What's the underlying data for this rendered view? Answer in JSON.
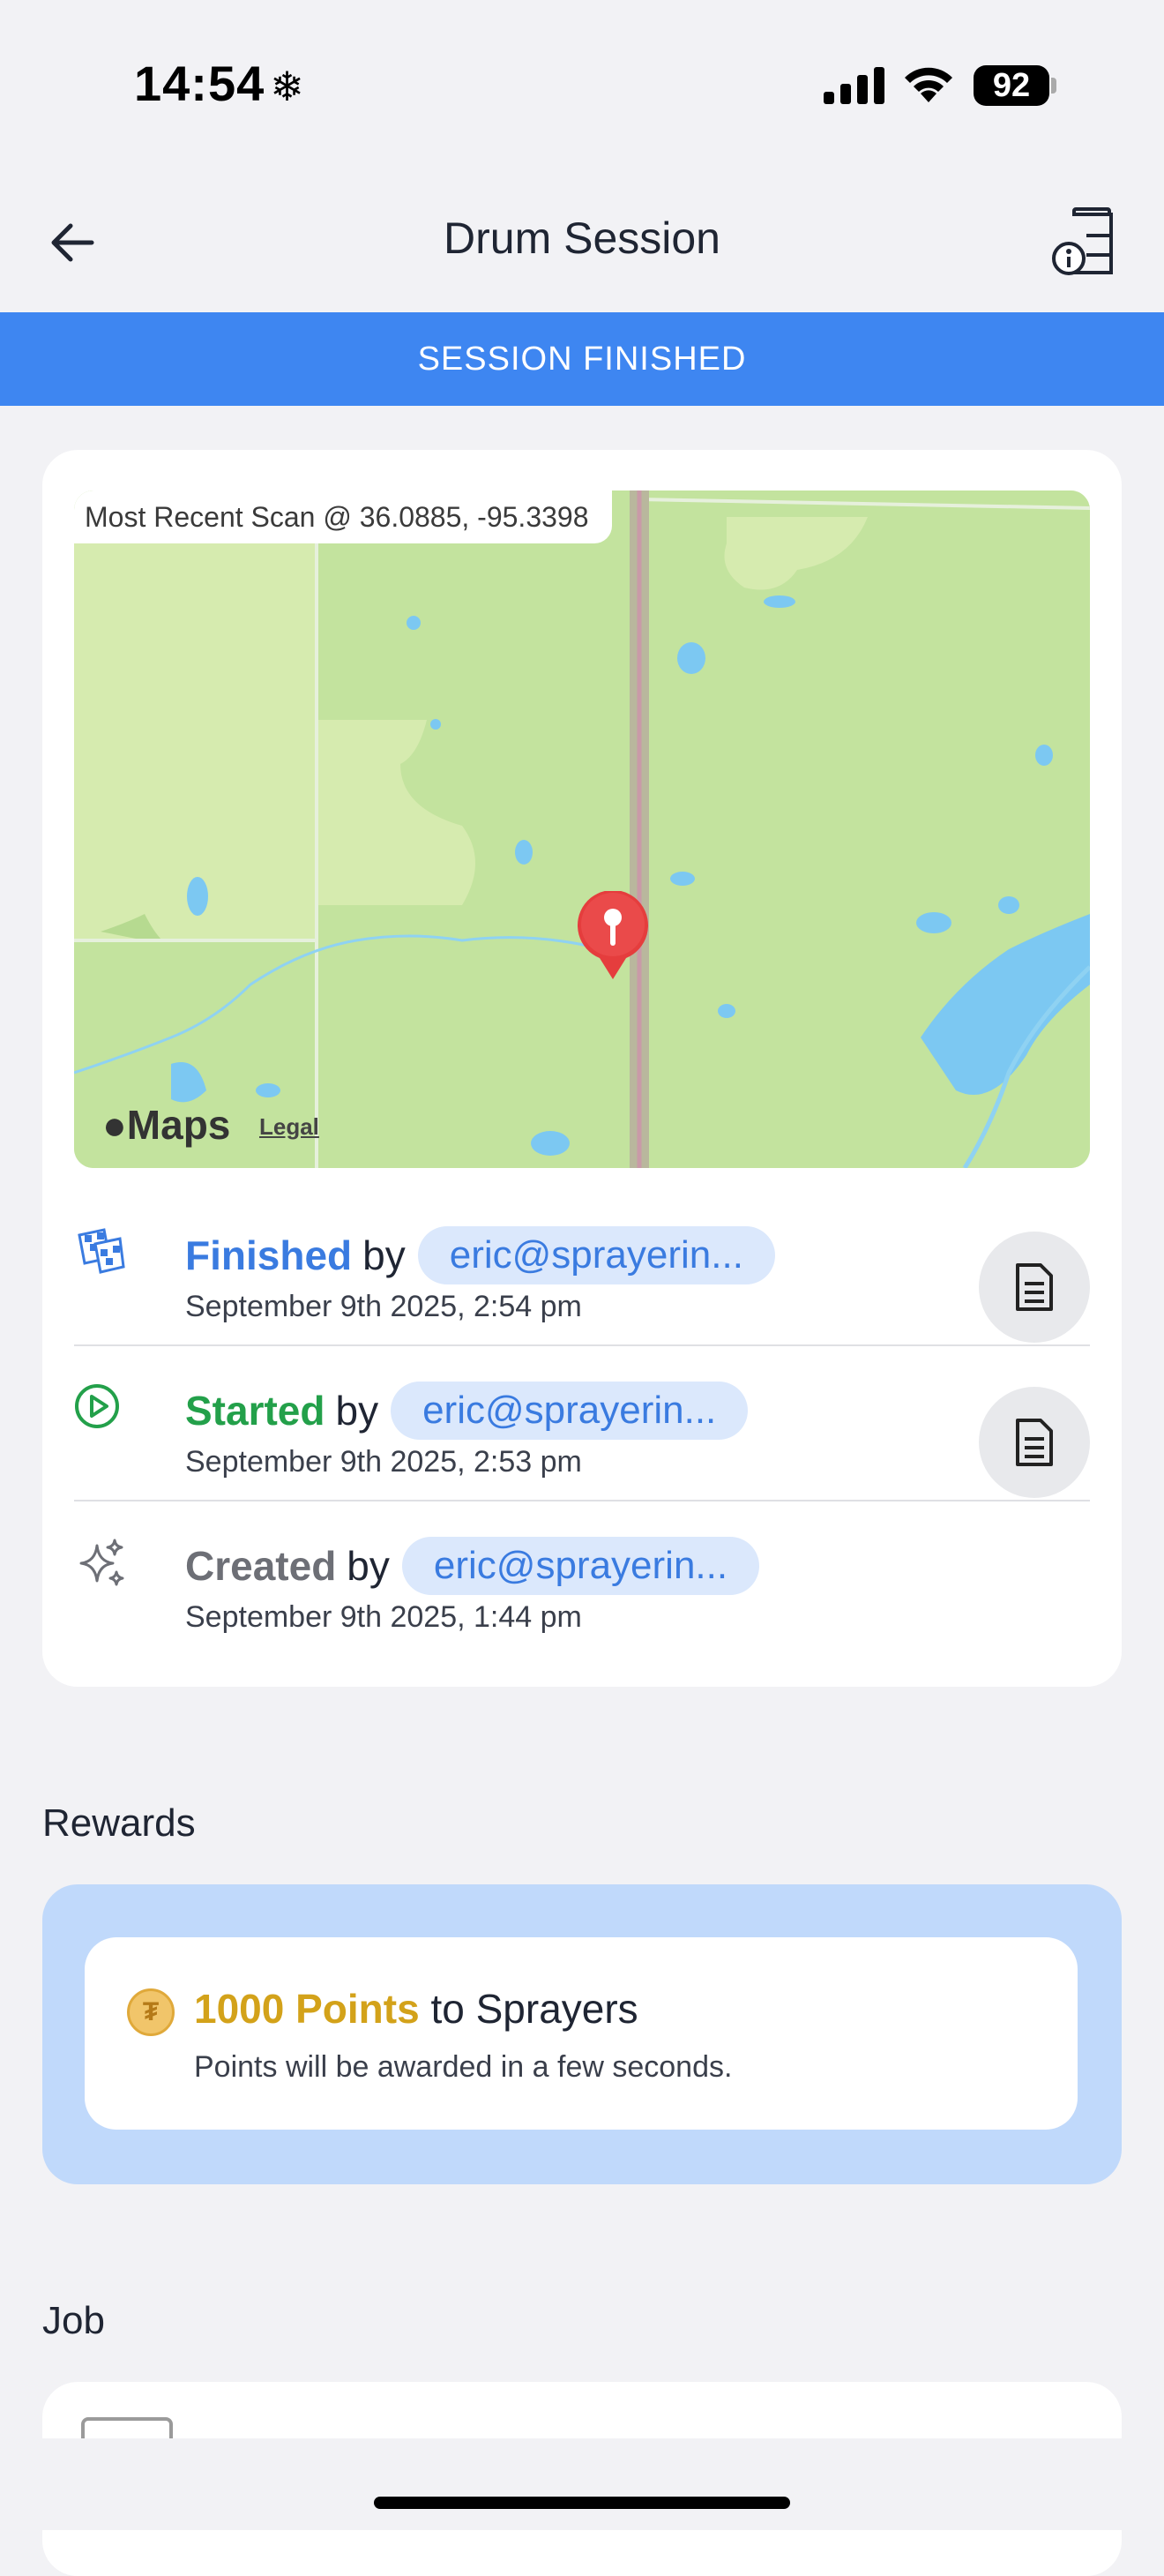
{
  "status_bar": {
    "time": "14:54",
    "snow": "❄",
    "battery": "92"
  },
  "nav": {
    "title": "Drum Session"
  },
  "banner": {
    "text": "SESSION FINISHED"
  },
  "map": {
    "label": "Most Recent Scan @ 36.0885, -95.3398",
    "logo": "Maps",
    "legal": "Legal"
  },
  "events": [
    {
      "status": "Finished",
      "by": "by",
      "user": "eric@sprayerin...",
      "date": "September 9th 2025, 2:54 pm",
      "color": "#3a7be0"
    },
    {
      "status": "Started",
      "by": "by",
      "user": "eric@sprayerin...",
      "date": "September 9th 2025, 2:53 pm",
      "color": "#23a04a"
    },
    {
      "status": "Created",
      "by": "by",
      "user": "eric@sprayerin...",
      "date": "September 9th 2025, 1:44 pm",
      "color": "#6d6f76"
    }
  ],
  "rewards": {
    "section_title": "Rewards",
    "points": "1000 Points",
    "to_text": "to Sprayers",
    "coin_symbol": "₮",
    "note": "Points will be awarded in a few seconds."
  },
  "job": {
    "section_title": "Job"
  },
  "colors": {
    "banner": "#3e86f1",
    "chip_bg": "#dbe8fc",
    "rewards_bg": "#c0d9fb",
    "points": "#d3a21a"
  }
}
